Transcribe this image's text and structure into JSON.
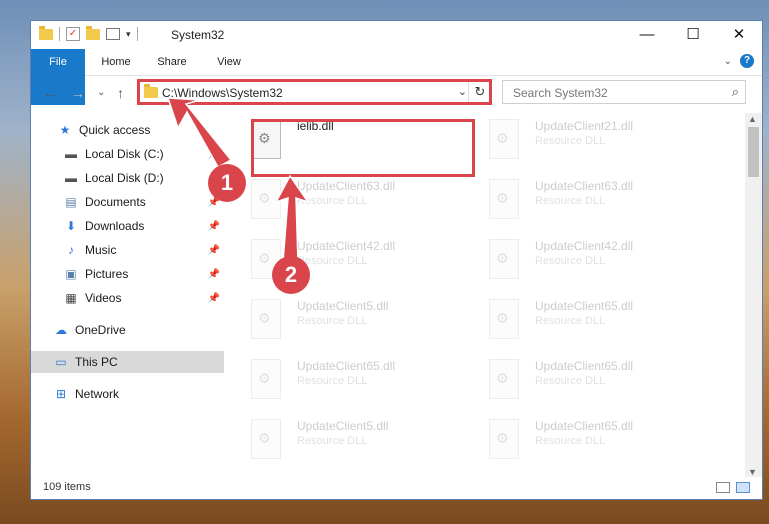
{
  "window": {
    "title": "System32"
  },
  "window_controls": {
    "minimize": "—",
    "maximize": "☐",
    "close": "✕"
  },
  "ribbon": {
    "tabs": [
      "File",
      "Home",
      "Share",
      "View"
    ],
    "help": "?",
    "collapse": "⌄"
  },
  "nav": {
    "back": "←",
    "forward": "→",
    "recent": "⌄",
    "up": "↑"
  },
  "address": {
    "path": "C:\\Windows\\System32",
    "dropdown": "⌄",
    "refresh": "↻"
  },
  "search": {
    "placeholder": "Search System32",
    "icon": "⌕"
  },
  "sidebar": {
    "items": [
      {
        "label": "Quick access",
        "icon": "★",
        "pinned": false
      },
      {
        "label": "Local Disk (C:)",
        "icon": "▬",
        "pinned": true
      },
      {
        "label": "Local Disk (D:)",
        "icon": "▬",
        "pinned": true
      },
      {
        "label": "Documents",
        "icon": "▤",
        "pinned": true
      },
      {
        "label": "Downloads",
        "icon": "⬇",
        "pinned": true
      },
      {
        "label": "Music",
        "icon": "♪",
        "pinned": true
      },
      {
        "label": "Pictures",
        "icon": "▣",
        "pinned": true
      },
      {
        "label": "Videos",
        "icon": "▦",
        "pinned": true
      },
      {
        "label": "OneDrive",
        "icon": "☁",
        "pinned": false
      },
      {
        "label": "This PC",
        "icon": "▭",
        "pinned": false,
        "selected": true
      },
      {
        "label": "Network",
        "icon": "⊞",
        "pinned": false
      }
    ],
    "pin_glyph": "📌"
  },
  "files": [
    {
      "name": "ielib.dll",
      "type": "",
      "faded": false
    },
    {
      "name": "UpdateClient21.dll",
      "type": "Resource DLL",
      "faded": true
    },
    {
      "name": "UpdateClient63.dll",
      "type": "Resource DLL",
      "faded": true
    },
    {
      "name": "UpdateClient63.dll",
      "type": "Resource DLL",
      "faded": true
    },
    {
      "name": "UpdateClient42.dll",
      "type": "Resource DLL",
      "faded": true
    },
    {
      "name": "UpdateClient42.dll",
      "type": "Resource DLL",
      "faded": true
    },
    {
      "name": "UpdateClient5.dll",
      "type": "Resource DLL",
      "faded": true
    },
    {
      "name": "UpdateClient65.dll",
      "type": "Resource DLL",
      "faded": true
    },
    {
      "name": "UpdateClient65.dll",
      "type": "Resource DLL",
      "faded": true
    },
    {
      "name": "UpdateClient65.dll",
      "type": "Resource DLL",
      "faded": true
    },
    {
      "name": "UpdateClient5.dll",
      "type": "Resource DLL",
      "faded": true
    },
    {
      "name": "UpdateClient65.dll",
      "type": "Resource DLL",
      "faded": true
    },
    {
      "name": "UpdateClient5.dll",
      "type": "Resource DLL",
      "faded": true
    },
    {
      "name": "UpdateClient65.dll",
      "type": "Resource DLL",
      "faded": true
    }
  ],
  "status": {
    "item_count": "109 items"
  },
  "annotations": {
    "step1": "1",
    "step2": "2"
  },
  "colors": {
    "accent": "#1979ca",
    "highlight": "#d9454a",
    "selection": "#d9d9d9"
  }
}
